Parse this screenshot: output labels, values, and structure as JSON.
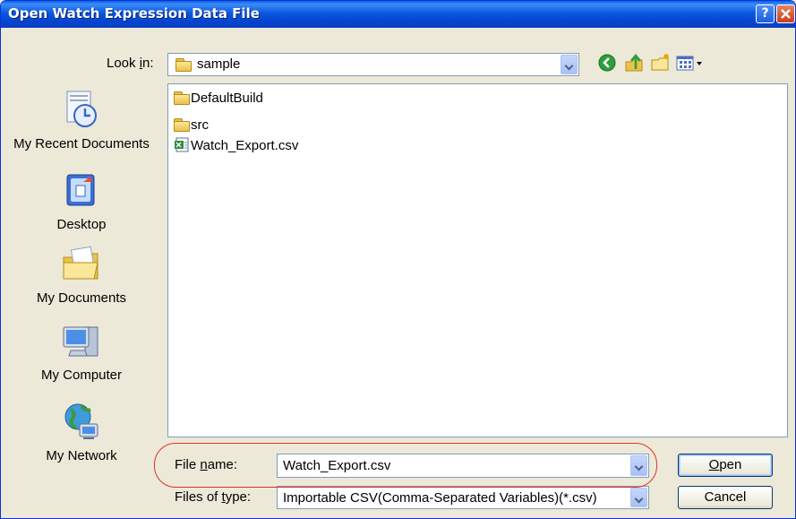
{
  "window": {
    "title": "Open Watch Expression Data File"
  },
  "title_buttons": {
    "help": "?",
    "close": "x"
  },
  "look_in": {
    "label_pre": "Look ",
    "label_key": "i",
    "label_post": "n:",
    "value": "sample"
  },
  "toolbar": [
    "back-icon",
    "up-folder-icon",
    "new-folder-icon",
    "view-menu-icon"
  ],
  "places": [
    {
      "label": "My Recent Documents",
      "icon": "recent-documents-icon"
    },
    {
      "label": "Desktop",
      "icon": "desktop-icon"
    },
    {
      "label": "My Documents",
      "icon": "my-documents-icon"
    },
    {
      "label": "My Computer",
      "icon": "my-computer-icon"
    },
    {
      "label": "My Network",
      "icon": "my-network-icon"
    }
  ],
  "files": [
    {
      "name": "DefaultBuild",
      "type": "folder"
    },
    {
      "name": "src",
      "type": "folder"
    },
    {
      "name": "Watch_Export.csv",
      "type": "csv"
    }
  ],
  "file_name": {
    "label_pre": "File ",
    "label_key": "n",
    "label_post": "ame:",
    "value": "Watch_Export.csv"
  },
  "file_type": {
    "label_pre": "Files of ",
    "label_key": "t",
    "label_post": "ype:",
    "value": "Importable CSV(Comma-Separated Variables)(*.csv)"
  },
  "buttons": {
    "open_key": "O",
    "open_rest": "pen",
    "cancel": "Cancel"
  },
  "colors": {
    "title_bar": "#0a58e0",
    "highlight": "#e0302a",
    "dialog_bg": "#ece9d8"
  }
}
